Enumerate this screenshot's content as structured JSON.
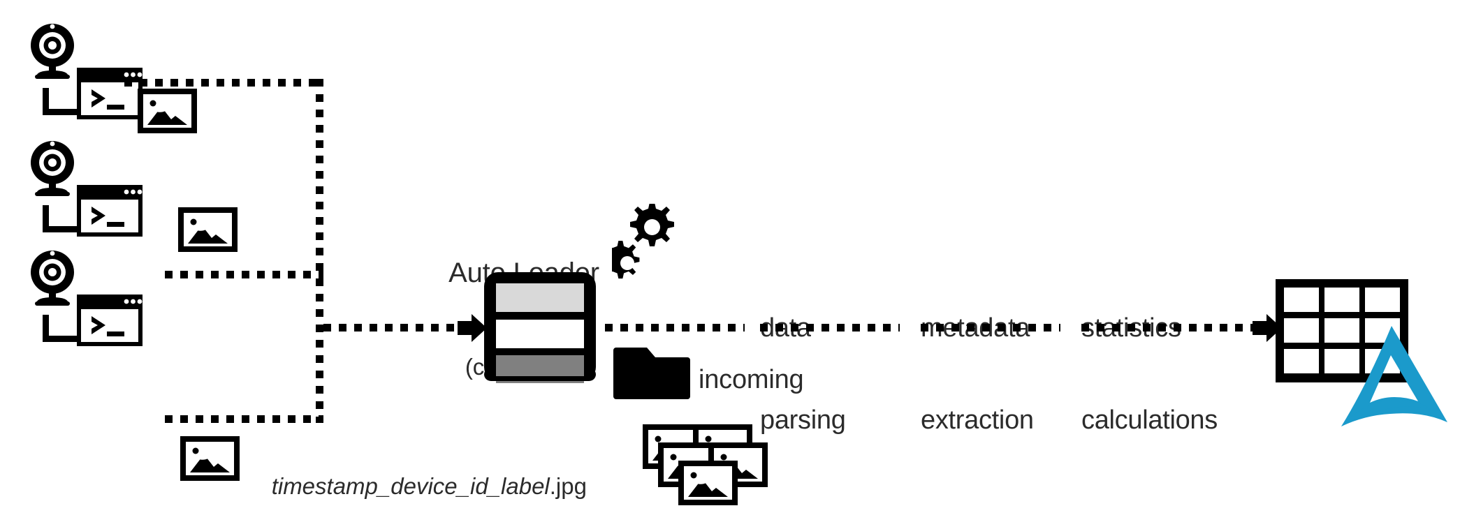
{
  "diagram": {
    "title_hidden": "",
    "background": "#ffffff",
    "ink": "#000000",
    "accent_blue": "#1B9ACB",
    "devices": [
      {
        "id": "device-1",
        "camera_icon": "webcam-icon",
        "terminal_icon": "terminal-window-icon",
        "image_icon": "image-file-icon"
      },
      {
        "id": "device-2",
        "camera_icon": "webcam-icon",
        "terminal_icon": "terminal-window-icon",
        "image_icon": "image-file-icon"
      },
      {
        "id": "device-3",
        "camera_icon": "webcam-icon",
        "terminal_icon": "terminal-window-icon",
        "image_icon": "image-file-icon"
      }
    ],
    "filename_label": {
      "name": "timestamp_device_id_label",
      "extension": ".jpg"
    },
    "auto_loader": {
      "line1": "Auto Loader",
      "line2": "(cloudFiles)",
      "gears_icon": "gears-icon",
      "stack_icon": "data-stack-icon",
      "stack_colors": [
        "#d9d9d9",
        "#ffffff",
        "#808080"
      ]
    },
    "incoming": {
      "folder_icon": "folder-icon",
      "label": "incoming",
      "images_icon": "image-stack-icon",
      "images_count": 5
    },
    "stages": [
      {
        "id": "stage-data-parsing",
        "line1": "data",
        "line2": "parsing"
      },
      {
        "id": "stage-metadata-extraction",
        "line1": "metadata",
        "line2": "extraction"
      },
      {
        "id": "stage-statistics-calculations",
        "line1": "statistics",
        "line2": "calculations"
      }
    ],
    "sink": {
      "table_icon": "table-grid-icon",
      "delta_icon": "delta-lake-logo",
      "table_rows": 3,
      "table_cols": 3
    }
  }
}
